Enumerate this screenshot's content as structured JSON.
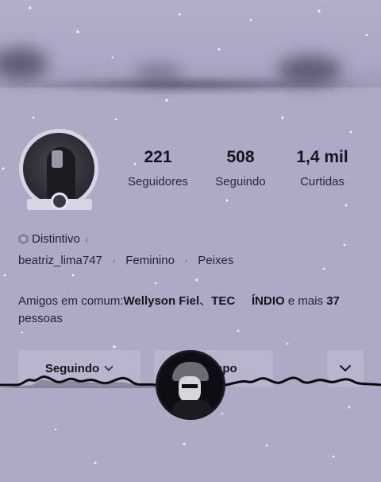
{
  "profile": {
    "stats": [
      {
        "value": "221",
        "label": "Seguidores"
      },
      {
        "value": "508",
        "label": "Seguindo"
      },
      {
        "value": "1,4 mil",
        "label": "Curtidas"
      }
    ],
    "badge": {
      "label": "Distintivo",
      "icon": "hexagon-badge-icon"
    },
    "username": "beatriz_lima747",
    "gender": "Feminino",
    "sign": "Peixes",
    "mutual": {
      "prefix": "Amigos em comum:",
      "name1": "Wellyson Fiel",
      "separator": "、",
      "name2": "TEC",
      "name3": "ÍNDIO",
      "middle": " e mais ",
      "count": "37",
      "suffix": "pessoas"
    }
  },
  "actions": {
    "following_label": "Seguindo",
    "group_label_partial": "apo",
    "more_icon": "chevron-down-icon"
  },
  "colors": {
    "background": "#aeaac6",
    "text": "#1f1d2b"
  }
}
